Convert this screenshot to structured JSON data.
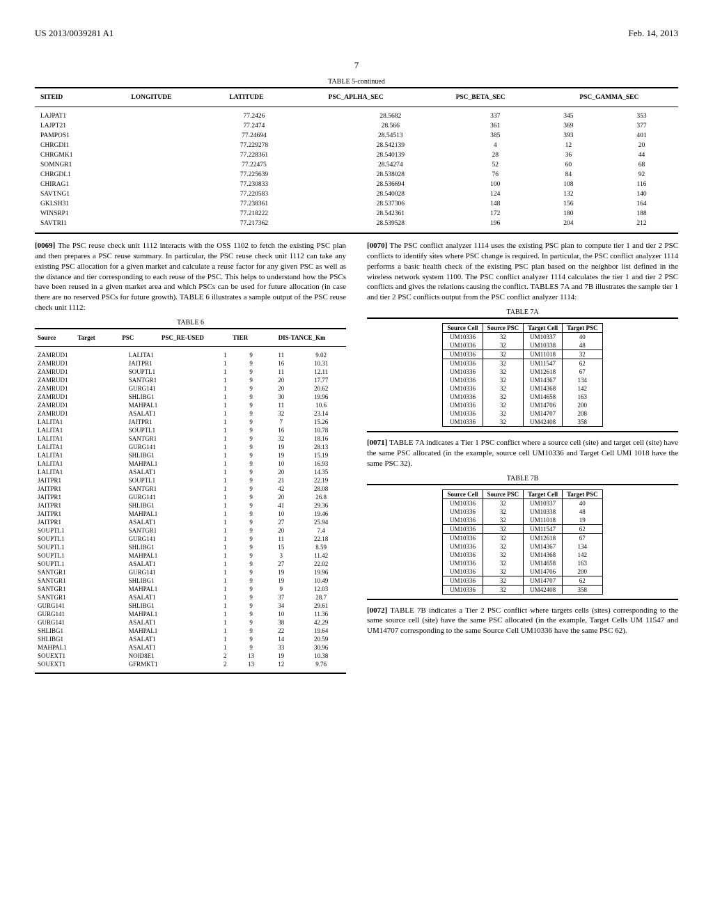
{
  "header": {
    "left": "US 2013/0039281 A1",
    "right": "Feb. 14, 2013"
  },
  "pagenum": "7",
  "table5": {
    "title": "TABLE 5-continued",
    "headers": [
      "SITEID",
      "LONGITUDE",
      "LATITUDE",
      "PSC_APLHA_SEC",
      "PSC_BETA_SEC",
      "PSC_GAMMA_SEC"
    ],
    "rows": [
      [
        "LAJPAT1",
        "77.2426",
        "28.5682",
        "337",
        "345",
        "353"
      ],
      [
        "LAJPT21",
        "77.2474",
        "28.566",
        "361",
        "369",
        "377"
      ],
      [
        "PAMPOS1",
        "77.24694",
        "28.54513",
        "385",
        "393",
        "401"
      ],
      [
        "CHRGDI1",
        "77.229278",
        "28.542139",
        "4",
        "12",
        "20"
      ],
      [
        "CHRGMK1",
        "77.228361",
        "28.540139",
        "28",
        "36",
        "44"
      ],
      [
        "SOMNGR1",
        "77.22475",
        "28.54274",
        "52",
        "60",
        "68"
      ],
      [
        "CHRGDL1",
        "77.225639",
        "28.538028",
        "76",
        "84",
        "92"
      ],
      [
        "CHIRAG1",
        "77.230833",
        "28.536694",
        "100",
        "108",
        "116"
      ],
      [
        "SAVTNG1",
        "77.220583",
        "28.540028",
        "124",
        "132",
        "140"
      ],
      [
        "GKLSH31",
        "77.238361",
        "28.537306",
        "148",
        "156",
        "164"
      ],
      [
        "WINSRP1",
        "77.218222",
        "28.542361",
        "172",
        "180",
        "188"
      ],
      [
        "SAVTRI1",
        "77.217362",
        "28.539528",
        "196",
        "204",
        "212"
      ]
    ]
  },
  "para69": {
    "num": "[0069]",
    "text": "The PSC reuse check unit 1112 interacts with the OSS 1102 to fetch the existing PSC plan and then prepares a PSC reuse summary. In particular, the PSC reuse check unit 1112 can take any existing PSC allocation for a given market and calculate a reuse factor for any given PSC as well as the distance and tier corresponding to each reuse of the PSC. This helps to understand how the PSCs have been reused in a given market area and which PSCs can be used for future allocation (in case there are no reserved PSCs for future growth). TABLE 6 illustrates a sample output of the PSC reuse check unit 1112:"
  },
  "table6": {
    "title": "TABLE 6",
    "headers": [
      "Source",
      "Target",
      "PSC",
      "PSC_RE-USED",
      "TIER",
      "DIS-TANCE_Km"
    ],
    "rows": [
      [
        "ZAMRUD1",
        "LALITA1",
        "1",
        "9",
        "11",
        "9.02"
      ],
      [
        "ZAMRUD1",
        "JAITPR1",
        "1",
        "9",
        "16",
        "10.31"
      ],
      [
        "ZAMRUD1",
        "SOUPTL1",
        "1",
        "9",
        "11",
        "12.11"
      ],
      [
        "ZAMRUD1",
        "SANTGR1",
        "1",
        "9",
        "20",
        "17.77"
      ],
      [
        "ZAMRUD1",
        "GURG141",
        "1",
        "9",
        "20",
        "20.62"
      ],
      [
        "ZAMRUD1",
        "SHLIBG1",
        "1",
        "9",
        "30",
        "19.96"
      ],
      [
        "ZAMRUD1",
        "MAHPAL1",
        "1",
        "9",
        "11",
        "10.6"
      ],
      [
        "ZAMRUD1",
        "ASALAT1",
        "1",
        "9",
        "32",
        "23.14"
      ],
      [
        "LALITA1",
        "JAITPR1",
        "1",
        "9",
        "7",
        "15.26"
      ],
      [
        "LALITA1",
        "SOUPTL1",
        "1",
        "9",
        "16",
        "10.78"
      ],
      [
        "LALITA1",
        "SANTGR1",
        "1",
        "9",
        "32",
        "18.16"
      ],
      [
        "LALITA1",
        "GURG141",
        "1",
        "9",
        "19",
        "28.13"
      ],
      [
        "LALITA1",
        "SHLIBG1",
        "1",
        "9",
        "19",
        "15.19"
      ],
      [
        "LALITA1",
        "MAHPAL1",
        "1",
        "9",
        "10",
        "16.93"
      ],
      [
        "LALITA1",
        "ASALAT1",
        "1",
        "9",
        "20",
        "14.35"
      ],
      [
        "JAITPR1",
        "SOUPTL1",
        "1",
        "9",
        "21",
        "22.19"
      ],
      [
        "JAITPR1",
        "SANTGR1",
        "1",
        "9",
        "42",
        "28.08"
      ],
      [
        "JAITPR1",
        "GURG141",
        "1",
        "9",
        "20",
        "26.8"
      ],
      [
        "JAITPR1",
        "SHLIBG1",
        "1",
        "9",
        "41",
        "29.36"
      ],
      [
        "JAITPR1",
        "MAHPAL1",
        "1",
        "9",
        "10",
        "19.46"
      ],
      [
        "JAITPR1",
        "ASALAT1",
        "1",
        "9",
        "27",
        "25.94"
      ],
      [
        "SOUPTL1",
        "SANTGR1",
        "1",
        "9",
        "20",
        "7.4"
      ],
      [
        "SOUPTL1",
        "GURG141",
        "1",
        "9",
        "11",
        "22.18"
      ],
      [
        "SOUPTL1",
        "SHLIBG1",
        "1",
        "9",
        "15",
        "8.59"
      ],
      [
        "SOUPTL1",
        "MAHPAL1",
        "1",
        "9",
        "3",
        "11.42"
      ],
      [
        "SOUPTL1",
        "ASALAT1",
        "1",
        "9",
        "27",
        "22.02"
      ],
      [
        "SANTGR1",
        "GURG141",
        "1",
        "9",
        "19",
        "19.96"
      ],
      [
        "SANTGR1",
        "SHLIBG1",
        "1",
        "9",
        "19",
        "10.49"
      ],
      [
        "SANTGR1",
        "MAHPAL1",
        "1",
        "9",
        "9",
        "12.03"
      ],
      [
        "SANTGR1",
        "ASALAT1",
        "1",
        "9",
        "37",
        "28.7"
      ],
      [
        "GURG141",
        "SHLIBG1",
        "1",
        "9",
        "34",
        "29.61"
      ],
      [
        "GURG141",
        "MAHPAL1",
        "1",
        "9",
        "10",
        "11.36"
      ],
      [
        "GURG141",
        "ASALAT1",
        "1",
        "9",
        "38",
        "42.29"
      ],
      [
        "SHLIBG1",
        "MAHPAL1",
        "1",
        "9",
        "22",
        "19.64"
      ],
      [
        "SHLIBG1",
        "ASALAT1",
        "1",
        "9",
        "14",
        "20.59"
      ],
      [
        "MAHPAL1",
        "ASALAT1",
        "1",
        "9",
        "33",
        "30.96"
      ],
      [
        "SOUEXT1",
        "NOID8E1",
        "2",
        "13",
        "19",
        "10.38"
      ],
      [
        "SOUEXT1",
        "GFRMKT1",
        "2",
        "13",
        "12",
        "9.76"
      ]
    ]
  },
  "para70": {
    "num": "[0070]",
    "text": "The PSC conflict analyzer 1114 uses the existing PSC plan to compute tier 1 and tier 2 PSC conflicts to identify sites where PSC change is required. In particular, the PSC conflict analyzer 1114 performs a basic health check of the existing PSC plan based on the neighbor list defined in the wireless network system 1100. The PSC conflict analyzer 1114 calculates the tier 1 and tier 2 PSC conflicts and gives the relations causing the conflict. TABLES 7A and 7B illustrates the sample tier 1 and tier 2 PSC conflicts output from the PSC conflict analyzer 1114:"
  },
  "table7a": {
    "title": "TABLE 7A",
    "headers": [
      "Source Cell",
      "Source PSC",
      "Target Cell",
      "Target PSC"
    ],
    "rows": [
      [
        "UM10336",
        "32",
        "UM10337",
        "40"
      ],
      [
        "UM10336",
        "32",
        "UM10338",
        "48"
      ],
      [
        "UM10336",
        "32",
        "UM11018",
        "32"
      ],
      [
        "UM10336",
        "32",
        "UM11547",
        "62"
      ],
      [
        "UM10336",
        "32",
        "UM12618",
        "67"
      ],
      [
        "UM10336",
        "32",
        "UM14367",
        "134"
      ],
      [
        "UM10336",
        "32",
        "UM14368",
        "142"
      ],
      [
        "UM10336",
        "32",
        "UM14658",
        "163"
      ],
      [
        "UM10336",
        "32",
        "UM14706",
        "200"
      ],
      [
        "UM10336",
        "32",
        "UM14707",
        "208"
      ],
      [
        "UM10336",
        "32",
        "UM42408",
        "358"
      ]
    ],
    "boxrow": 2
  },
  "para71": {
    "num": "[0071]",
    "text": "TABLE 7A indicates a Tier 1 PSC conflict where a source cell (site) and target cell (site) have the same PSC allocated (in the example, source cell UM10336 and Target Cell UMI 1018 have the same PSC 32)."
  },
  "table7b": {
    "title": "TABLE 7B",
    "headers": [
      "Source Cell",
      "Source PSC",
      "Target Cell",
      "Target PSC"
    ],
    "rows": [
      [
        "UM10336",
        "32",
        "UM10337",
        "40"
      ],
      [
        "UM10336",
        "32",
        "UM10338",
        "48"
      ],
      [
        "UM10336",
        "32",
        "UM11018",
        "19"
      ],
      [
        "UM10336",
        "32",
        "UM11547",
        "62"
      ],
      [
        "UM10336",
        "32",
        "UM12618",
        "67"
      ],
      [
        "UM10336",
        "32",
        "UM14367",
        "134"
      ],
      [
        "UM10336",
        "32",
        "UM14368",
        "142"
      ],
      [
        "UM10336",
        "32",
        "UM14658",
        "163"
      ],
      [
        "UM10336",
        "32",
        "UM14706",
        "200"
      ],
      [
        "UM10336",
        "32",
        "UM14707",
        "62"
      ],
      [
        "UM10336",
        "32",
        "UM42408",
        "358"
      ]
    ],
    "boxrows": [
      3,
      9
    ]
  },
  "para72": {
    "num": "[0072]",
    "text": "TABLE 7B indicates a Tier 2 PSC conflict where targets cells (sites) corresponding to the same source cell (site) have the same PSC allocated (in the example, Target Cells UM 11547 and UM14707 corresponding to the same Source Cell UM10336 have the same PSC 62)."
  }
}
